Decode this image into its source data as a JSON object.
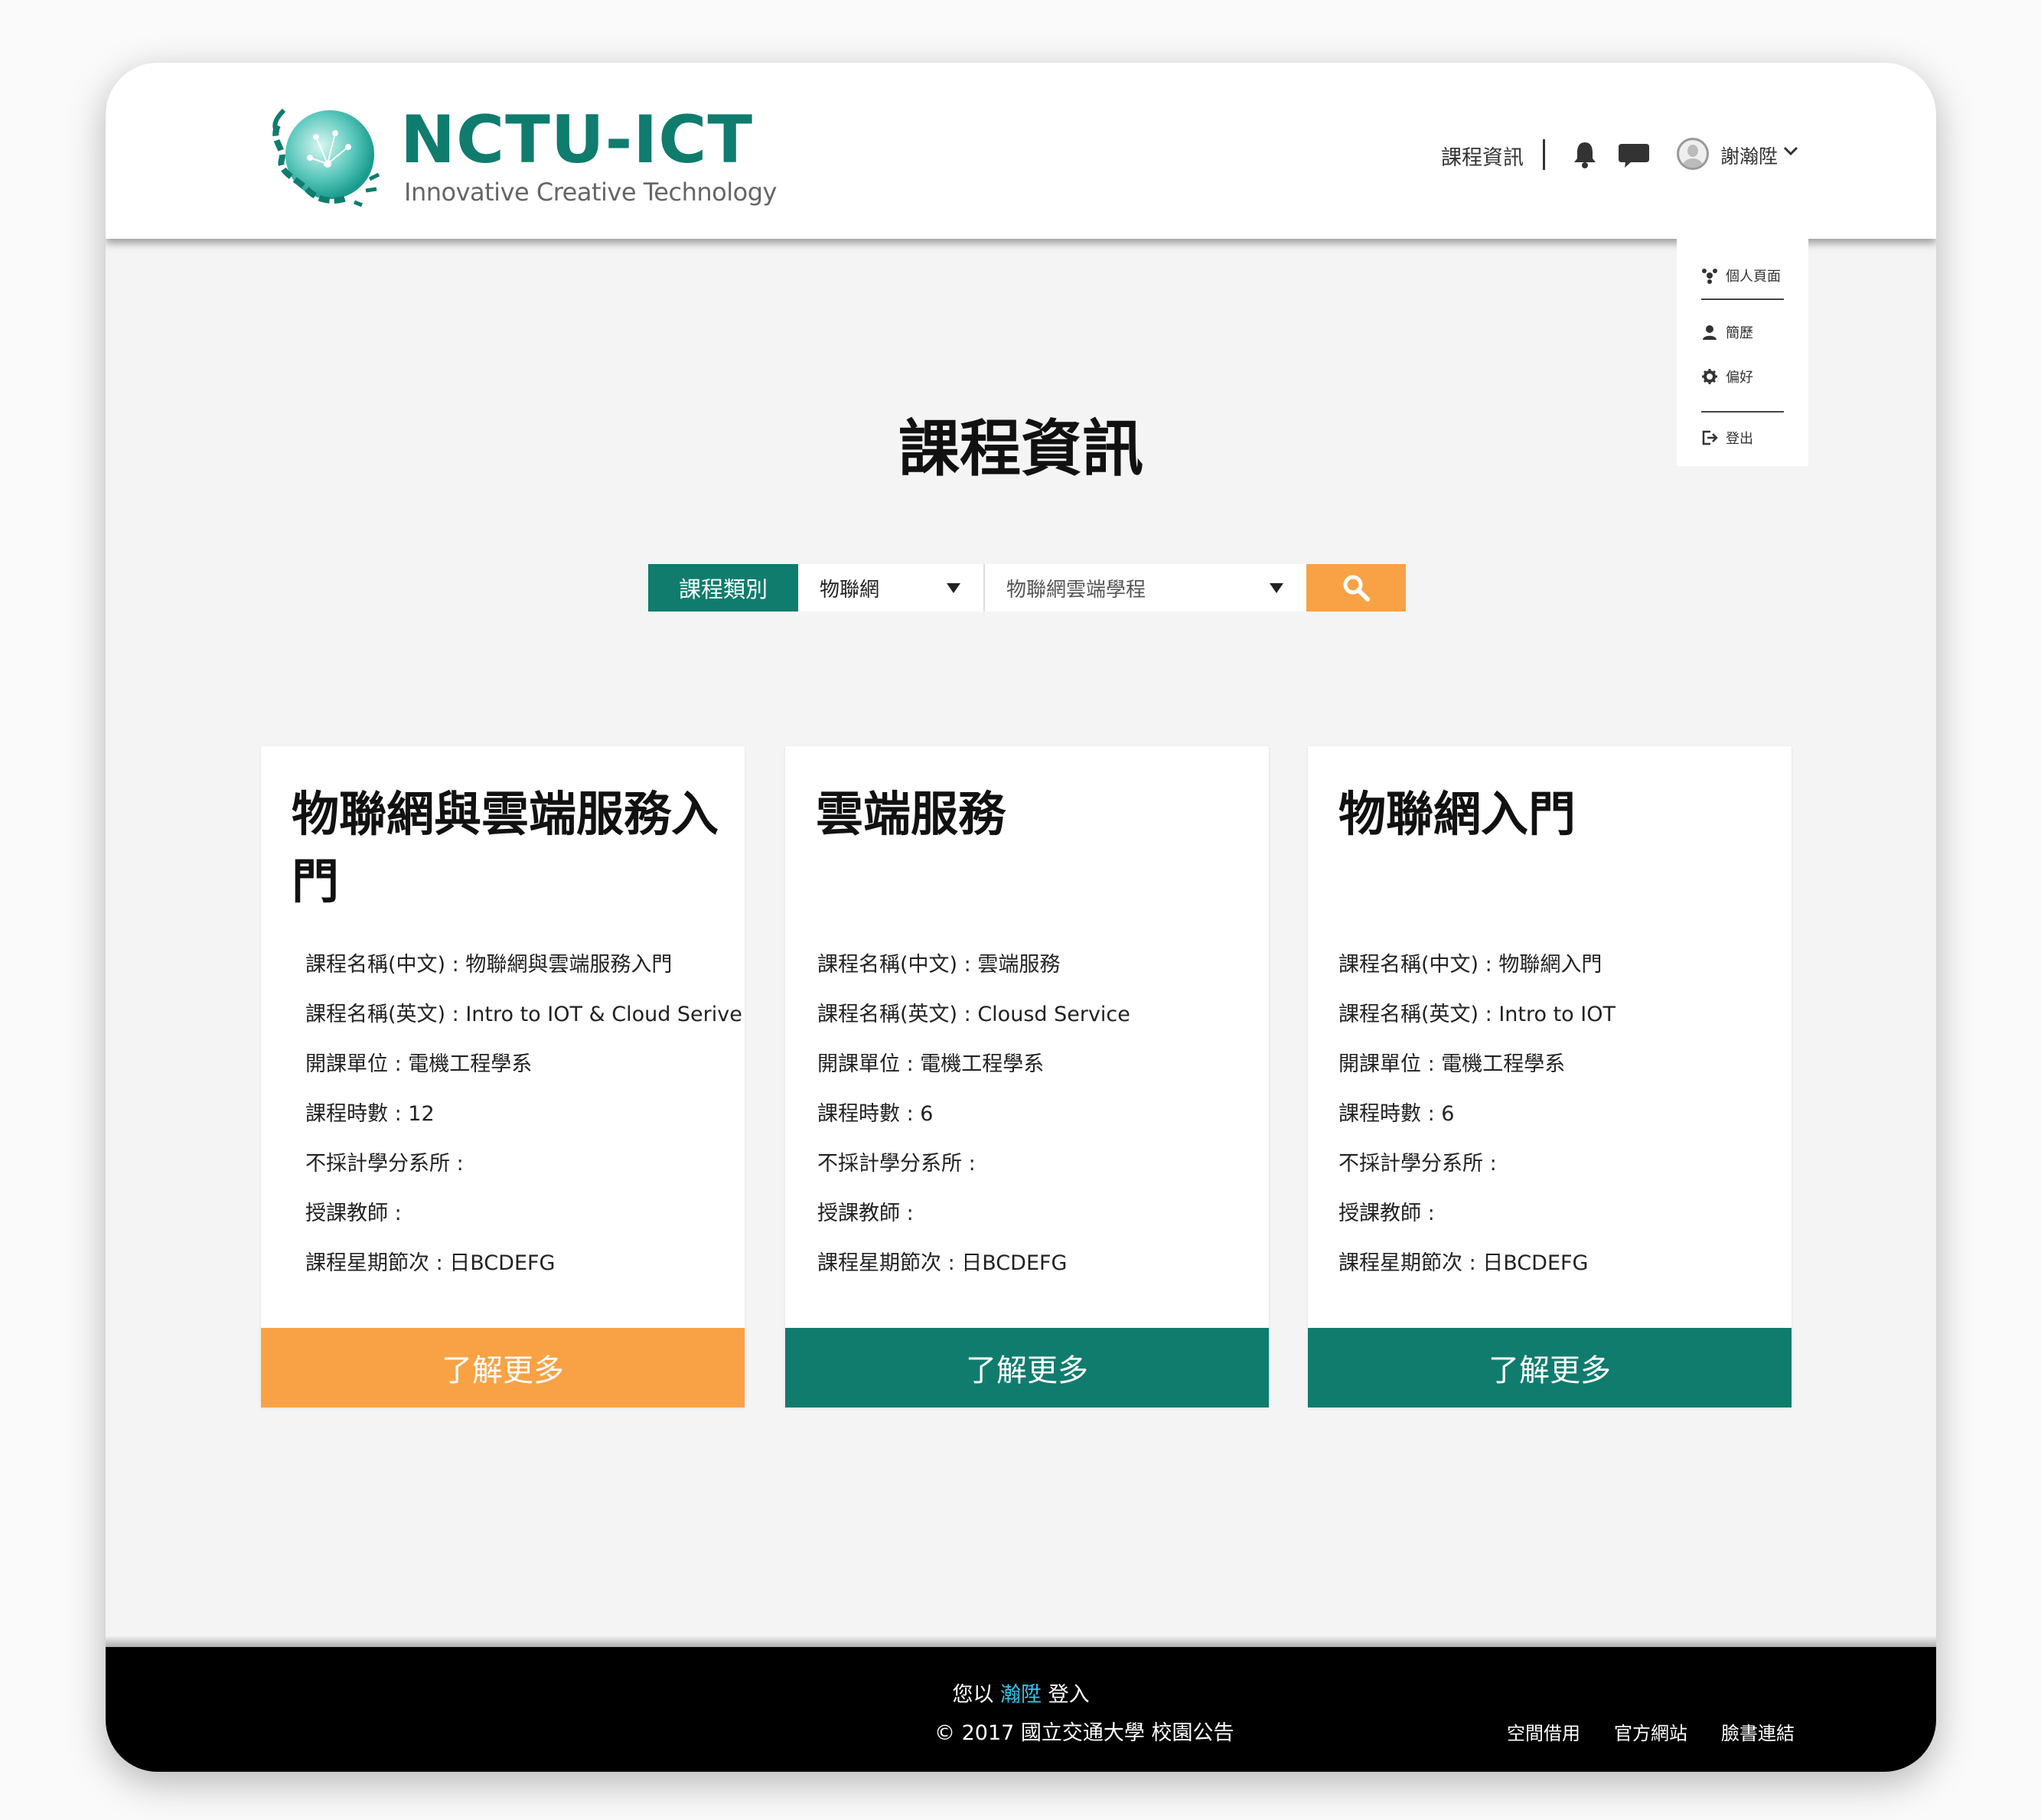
{
  "header": {
    "logo_title": "NCTU-ICT",
    "logo_subtitle": "Innovative Creative Technology",
    "nav_course_info": "課程資訊",
    "user_name": "謝瀚陞"
  },
  "user_menu": {
    "items": [
      {
        "label": "個人頁面",
        "icon": "profile-page-icon"
      },
      {
        "label": "簡歷",
        "icon": "user-icon"
      },
      {
        "label": "偏好",
        "icon": "gear-icon"
      },
      {
        "label": "登出",
        "icon": "logout-icon"
      }
    ]
  },
  "page": {
    "title": "課程資訊"
  },
  "search": {
    "category_label": "課程類別",
    "category_value": "物聯網",
    "program_value": "物聯網雲端學程",
    "button_icon": "search-icon"
  },
  "field_labels": {
    "name_zh": "課程名稱(中文)",
    "name_en": "課程名稱(英文)",
    "unit": "開課單位",
    "hours": "課程時數",
    "excluded": "不採計學分系所",
    "teacher": "授課教師",
    "schedule": "課程星期節次"
  },
  "courses": [
    {
      "title": "物聯網與雲端服務入門",
      "name_zh": "課程名稱(中文) : 物聯網與雲端服務入門",
      "name_en": "課程名稱(英文) : Intro to IOT & Cloud Serive",
      "unit": "開課單位 : 電機工程學系",
      "hours": "課程時數 : 12",
      "excluded": "不採計學分系所 :",
      "teacher": "授課教師 :",
      "schedule": "課程星期節次 : 日BCDEFG",
      "button": "了解更多",
      "button_color": "#f9a245"
    },
    {
      "title": "雲端服務",
      "name_zh": "課程名稱(中文) : 雲端服務",
      "name_en": "課程名稱(英文) : Clousd Service",
      "unit": "開課單位 : 電機工程學系",
      "hours": "課程時數 : 6",
      "excluded": "不採計學分系所 :",
      "teacher": "授課教師 :",
      "schedule": "課程星期節次 : 日BCDEFG",
      "button": "了解更多",
      "button_color": "#0f7c6e"
    },
    {
      "title": "物聯網入門",
      "name_zh": "課程名稱(中文) : 物聯網入門",
      "name_en": "課程名稱(英文) : Intro to IOT",
      "unit": "開課單位 : 電機工程學系",
      "hours": "課程時數 : 6",
      "excluded": "不採計學分系所 :",
      "teacher": "授課教師 :",
      "schedule": "課程星期節次 : 日BCDEFG",
      "button": "了解更多",
      "button_color": "#0f7c6e"
    }
  ],
  "footer": {
    "login_prefix": "您以",
    "login_user": "瀚陞",
    "login_suffix": "登入",
    "copyright": "© 2017 國立交通大學 校園公告",
    "links": [
      "空間借用",
      "官方網站",
      "臉書連結"
    ]
  },
  "colors": {
    "brand_teal": "#0f7c6e",
    "accent_orange": "#f9a245",
    "footer_bg": "#000000",
    "highlight_blue": "#2fc6ea"
  }
}
